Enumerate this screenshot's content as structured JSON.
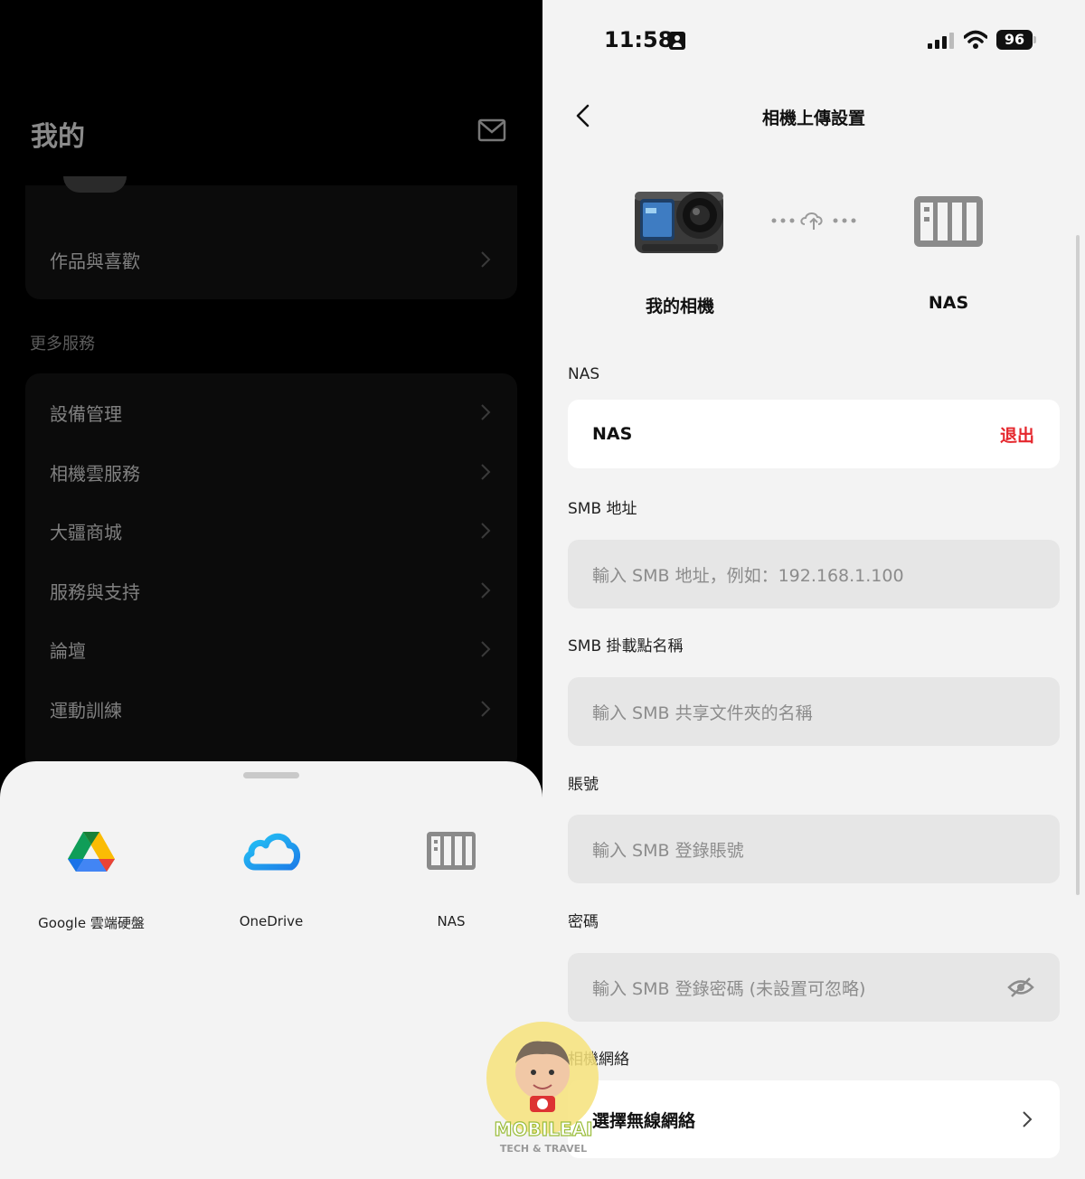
{
  "left": {
    "title": "我的",
    "works_row": "作品與喜歡",
    "section_label": "更多服務",
    "services": [
      "設備管理",
      "相機雲服務",
      "大疆商城",
      "服務與支持",
      "論壇",
      "運動訓練"
    ],
    "sheet": {
      "options": [
        {
          "label": "Google 雲端硬盤",
          "icon": "google-drive-icon"
        },
        {
          "label": "OneDrive",
          "icon": "onedrive-icon"
        },
        {
          "label": "NAS",
          "icon": "nas-icon"
        }
      ]
    }
  },
  "right": {
    "status": {
      "time": "11:58",
      "battery": "96"
    },
    "nav_title": "相機上傳設置",
    "camera_caption": "我的相機",
    "nas_caption": "NAS",
    "nas_section": {
      "label": "NAS",
      "value": "NAS",
      "action": "退出"
    },
    "smb_address": {
      "label": "SMB 地址",
      "placeholder": "輸入 SMB 地址，例如：192.168.1.100"
    },
    "smb_mount": {
      "label": "SMB 掛載點名稱",
      "placeholder": "輸入 SMB 共享文件夾的名稱"
    },
    "account": {
      "label": "賬號",
      "placeholder": "輸入 SMB 登錄賬號"
    },
    "password": {
      "label": "密碼",
      "placeholder": "輸入 SMB 登錄密碼 (未設置可忽略)"
    },
    "network": {
      "label": "相機網絡",
      "value": "選擇無線網絡"
    }
  },
  "colors": {
    "accent_red": "#e5272d",
    "sheet_bg": "#f3f3f3",
    "field_bg": "#e6e6e6"
  },
  "watermark": {
    "brand": "MOBILEAI",
    "tagline": "TECH & TRAVEL"
  }
}
